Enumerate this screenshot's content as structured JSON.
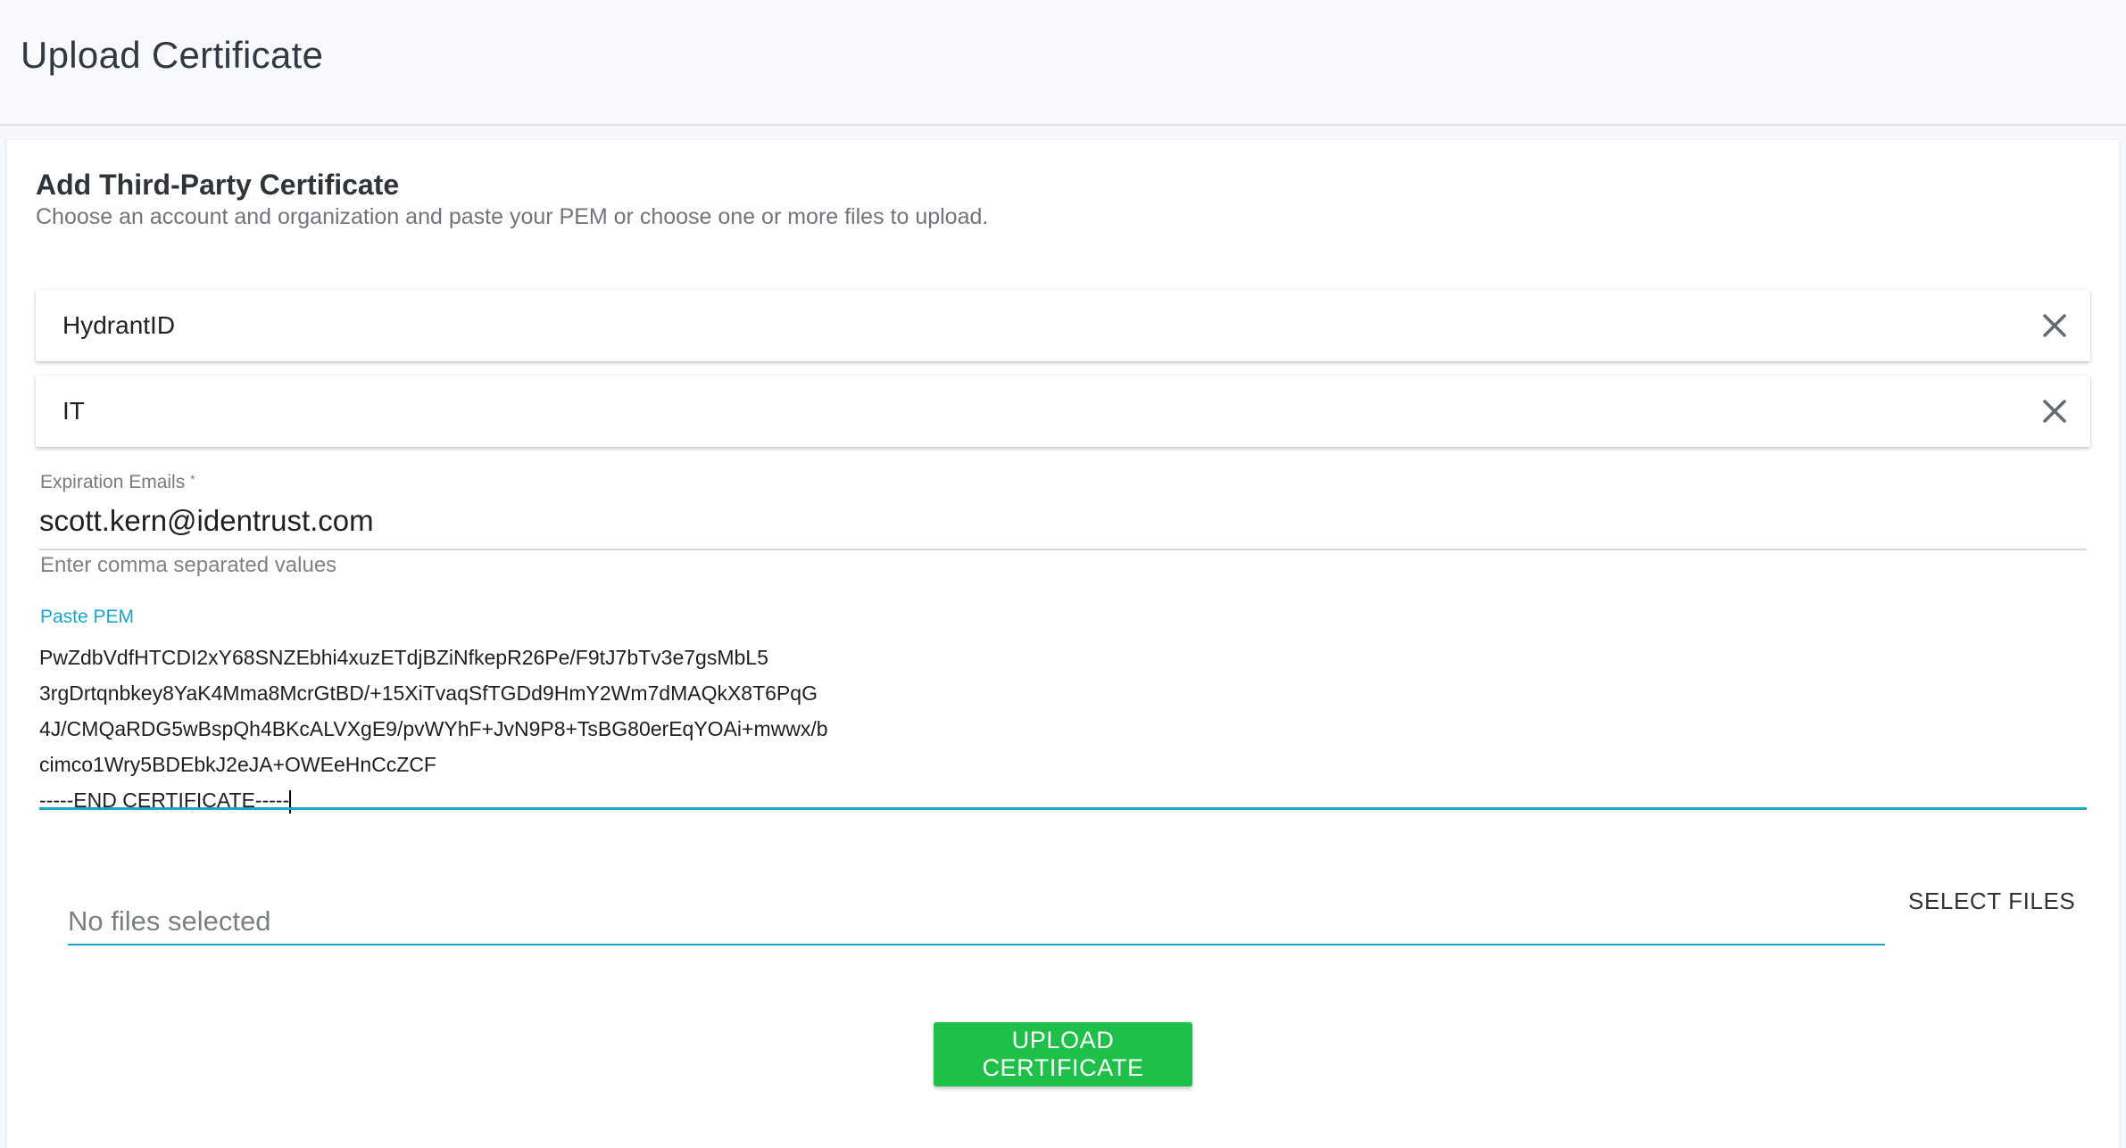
{
  "header": {
    "title": "Upload Certificate"
  },
  "card": {
    "title": "Add Third-Party Certificate",
    "subtitle": "Choose an account and organization and paste your PEM or choose one or more files to upload."
  },
  "account_select": {
    "value": "HydrantID",
    "clear_icon": "close-icon"
  },
  "organization_select": {
    "value": "IT",
    "clear_icon": "close-icon"
  },
  "expiration_emails": {
    "label": "Expiration Emails",
    "required_mark": "*",
    "value": "scott.kern@identrust.com",
    "hint": "Enter comma separated values"
  },
  "pem": {
    "label": "Paste PEM",
    "lines": [
      "PwZdbVdfHTCDI2xY68SNZEbhi4xuzETdjBZiNfkepR26Pe/F9tJ7bTv3e7gsMbL5",
      "3rgDrtqnbkey8YaK4Mma8McrGtBD/+15XiTvaqSfTGDd9HmY2Wm7dMAQkX8T6PqG",
      "4J/CMQaRDG5wBspQh4BKcALVXgE9/pvWYhF+JvN9P8+TsBG80erEqYOAi+mwwx/b",
      "cimco1Wry5BDEbkJ2eJA+OWEeHnCcZCF",
      "-----END CERTIFICATE-----"
    ]
  },
  "files": {
    "placeholder": "No files selected",
    "select_label": "SELECT FILES"
  },
  "actions": {
    "upload_label": "UPLOAD CERTIFICATE"
  },
  "colors": {
    "accent": "#1ba6c8",
    "upload_button": "#1ec04a"
  }
}
